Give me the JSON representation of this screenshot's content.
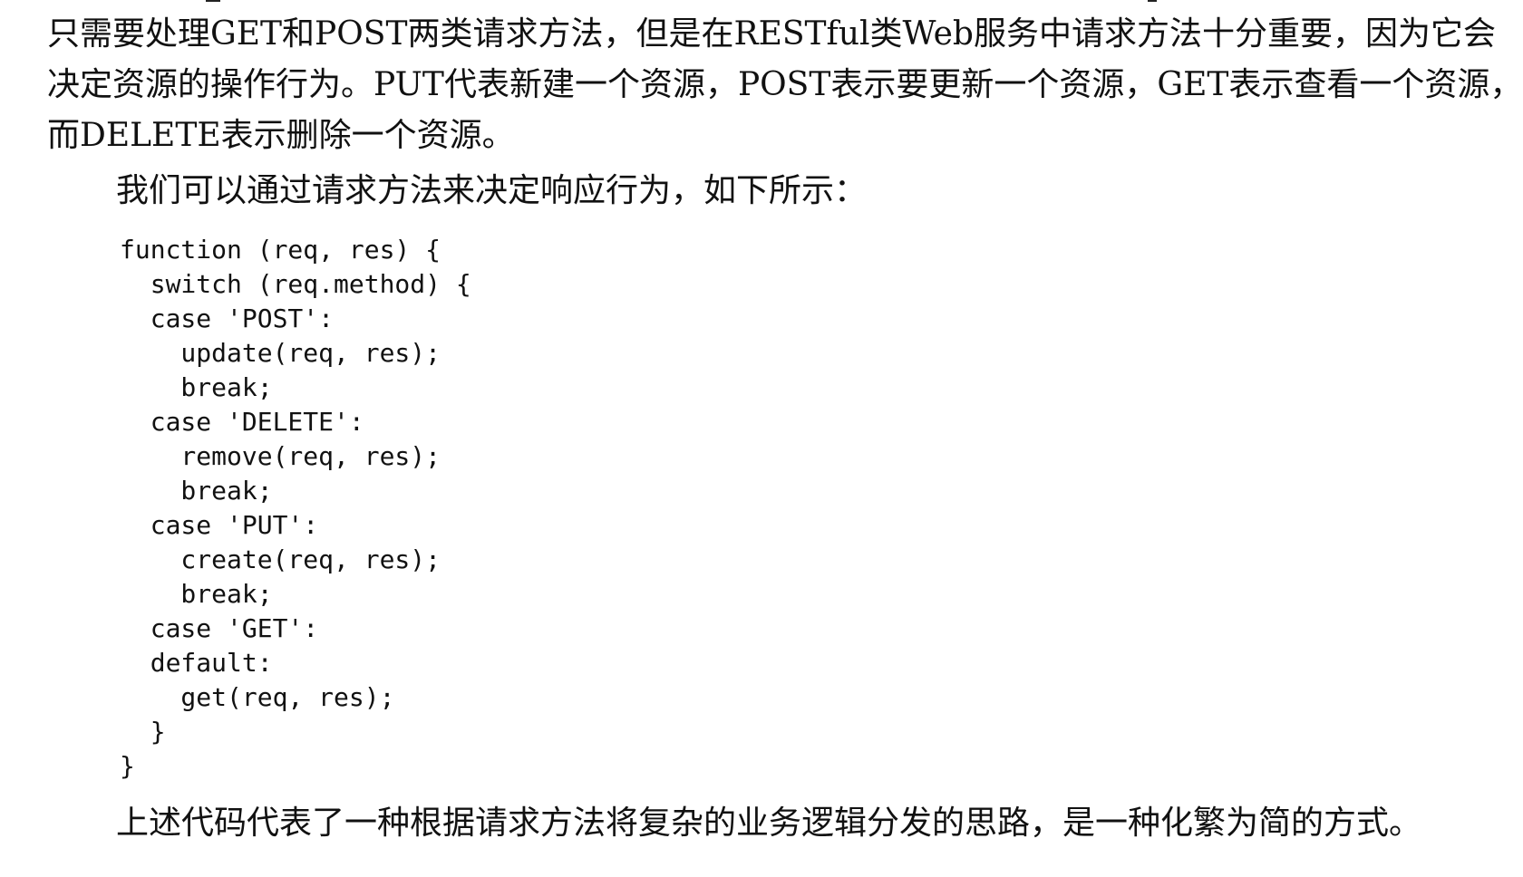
{
  "paragraph_top": {
    "line1": "只需要处理GET和POST两类请求方法，但是在RESTful类Web服务中请求方法十分重要，因为它会",
    "line2": "决定资源的操作行为。PUT代表新建一个资源，POST表示要更新一个资源，GET表示查看一个资源，",
    "line3": "而DELETE表示删除一个资源。"
  },
  "paragraph_intro": "我们可以通过请求方法来决定响应行为，如下所示：",
  "code_lines": [
    "function (req, res) {",
    "  switch (req.method) {",
    "  case 'POST':",
    "    update(req, res);",
    "    break;",
    "  case 'DELETE':",
    "    remove(req, res);",
    "    break;",
    "  case 'PUT':",
    "    create(req, res);",
    "    break;",
    "  case 'GET':",
    "  default:",
    "    get(req, res);",
    "  }",
    "}"
  ],
  "paragraph_bottom": "上述代码代表了一种根据请求方法将复杂的业务逻辑分发的思路，是一种化繁为简的方式。"
}
